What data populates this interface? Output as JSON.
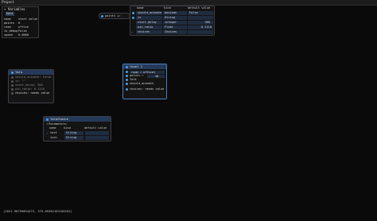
{
  "window": {
    "title": "Project"
  },
  "variables_panel": {
    "title": "Variables",
    "edit_label": "Edit",
    "rows": [
      {
        "name": "name",
        "value": "start value"
      },
      {
        "name": "points",
        "value": "0"
      },
      {
        "name": "room",
        "value": "office"
      },
      {
        "name": "is_debug",
        "value": "False"
      },
      {
        "name": "speed",
        "value": "0.0000"
      }
    ]
  },
  "points_node": {
    "label": "points +="
  },
  "var_table_node": {
    "columns": [
      "name",
      "kind",
      "default value"
    ],
    "rows": [
      {
        "name": "should_animate",
        "kind": "boolean",
        "value": "False"
      },
      {
        "name": "is",
        "kind": "String",
        "value": ""
      },
      {
        "name": "start_delay",
        "kind": "integer",
        "value": "300"
      },
      {
        "name": "win_ratio",
        "kind": "Float",
        "value": "0.1110"
      },
      {
        "name": "choices",
        "kind": "Choices",
        "value": ""
      }
    ]
  },
  "talk_node": {
    "title": "Talk",
    "fields": [
      "should_animate: False",
      "is: \"\"",
      "start_delay: 300",
      "win_ratio: 0.1110",
      "choices: needs value"
    ]
  },
  "level_node": {
    "title": "level 1",
    "rows": [
      {
        "label": "room = office1",
        "value": ""
      },
      {
        "label": "points =",
        "value": "10"
      },
      {
        "label": "Talk",
        "value": ""
      },
      {
        "label": "should_animate",
        "value": ""
      }
    ],
    "footer": "choices: needs value"
  },
  "talk_choice_node": {
    "title": "TalkChoice",
    "params_label": "Parameters:",
    "columns": [
      "name",
      "kind",
      "default value"
    ],
    "rows": [
      {
        "name": "text",
        "kind": "String",
        "value": ""
      },
      {
        "name": "icon",
        "kind": "String",
        "value": ""
      }
    ]
  },
  "status": {
    "coords": "(2621.90795094475, 375.05381103156252)"
  },
  "colors": {
    "accent": "#4a9fe8",
    "node_header": "#253a5a",
    "background": "#0a0a0a"
  }
}
